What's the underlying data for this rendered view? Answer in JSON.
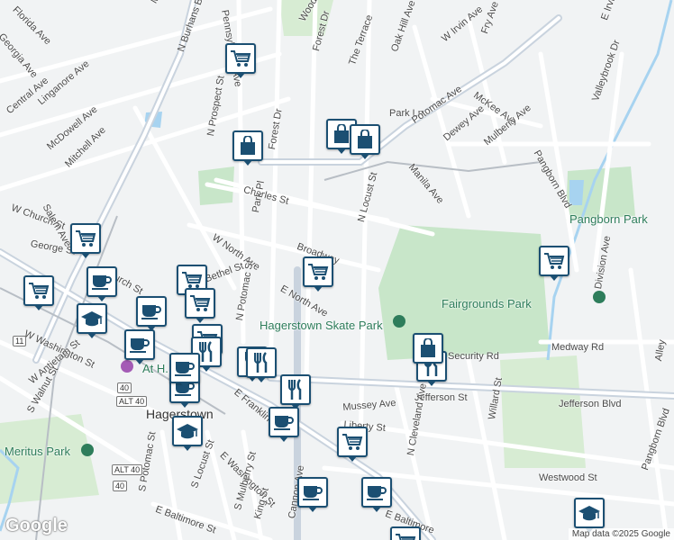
{
  "map": {
    "logo": "Google",
    "attribution": "Map data ©2025 Google",
    "colors": {
      "road": "#ffffff",
      "major_road": "#c9d3de",
      "park": "#c8e6c9",
      "water": "#a7d3f0",
      "marker_border": "#1b4f72",
      "marker_icon": "#1b4f72"
    },
    "road_labels": [
      "Florida Ave",
      "Georgia Ave",
      "N Burhans Blvd",
      "Mulberry",
      "Pennsylvania Ave",
      "Woodland Way",
      "Forest Dr",
      "The Terrace",
      "Oak Hill Ave",
      "W Irvin Ave",
      "Fry Ave",
      "E Irvin Ave",
      "Central Ave",
      "Linganore Ave",
      "McDowell Ave",
      "Mitchell Ave",
      "N Prospect St",
      "Forest Dr",
      "Park Ln",
      "Potomac Ave",
      "McKee Ave",
      "Dewey Ave",
      "Mulberry Ave",
      "Manila Ave",
      "Pangborn Blvd",
      "Valleybrook Dr",
      "Charles St",
      "Park Pl",
      "N Locust St",
      "W Church St",
      "Salem Ave",
      "George St",
      "W North Ave",
      "Broadway",
      "Church St",
      "Bethel St",
      "N Potomac St",
      "E North Ave",
      "W Washington St",
      "W Antietam St",
      "S Walnut St",
      "E Franklin St",
      "Medway Rd",
      "Security Rd",
      "Jefferson St",
      "Jefferson Blvd",
      "Mussey Ave",
      "Liberty St",
      "N Cleveland Ave",
      "Willard St",
      "Division Ave",
      "Alley",
      "Westwood St",
      "Pangborn Blvd",
      "E Washington St",
      "S Potomac St",
      "S Locust St",
      "S Mulberry St",
      "E Baltimore St",
      "King St",
      "Cannon Ave",
      "E Baltimore"
    ],
    "poi_labels": [
      "Hagerstown Skate Park",
      "Fairgrounds Park",
      "Pangborn Park",
      "Meritus Park",
      "At H..."
    ],
    "city_label": "Hagerstown",
    "route_shields": [
      "11",
      "40",
      "ALT 40",
      "40",
      "ALT 40"
    ],
    "markers": [
      {
        "icon": "cart-icon"
      },
      {
        "icon": "bag-icon"
      },
      {
        "icon": "bag-icon"
      },
      {
        "icon": "bag-icon"
      },
      {
        "icon": "cart-icon"
      },
      {
        "icon": "cart-icon"
      },
      {
        "icon": "cart-icon"
      },
      {
        "icon": "cart-icon"
      },
      {
        "icon": "cup-icon"
      },
      {
        "icon": "cart-icon"
      },
      {
        "icon": "cart-icon"
      },
      {
        "icon": "school-icon"
      },
      {
        "icon": "cup-icon"
      },
      {
        "icon": "cup-icon"
      },
      {
        "icon": "cart-icon"
      },
      {
        "icon": "fork-knife-icon"
      },
      {
        "icon": "fork-knife-icon"
      },
      {
        "icon": "fork-knife-icon"
      },
      {
        "icon": "cup-icon"
      },
      {
        "icon": "cup-icon"
      },
      {
        "icon": "fork-knife-icon"
      },
      {
        "icon": "cup-icon"
      },
      {
        "icon": "school-icon"
      },
      {
        "icon": "cart-icon"
      },
      {
        "icon": "bag-icon"
      },
      {
        "icon": "fork-knife-icon"
      },
      {
        "icon": "cup-icon"
      },
      {
        "icon": "cup-icon"
      },
      {
        "icon": "cart-icon"
      },
      {
        "icon": "school-icon"
      }
    ]
  }
}
